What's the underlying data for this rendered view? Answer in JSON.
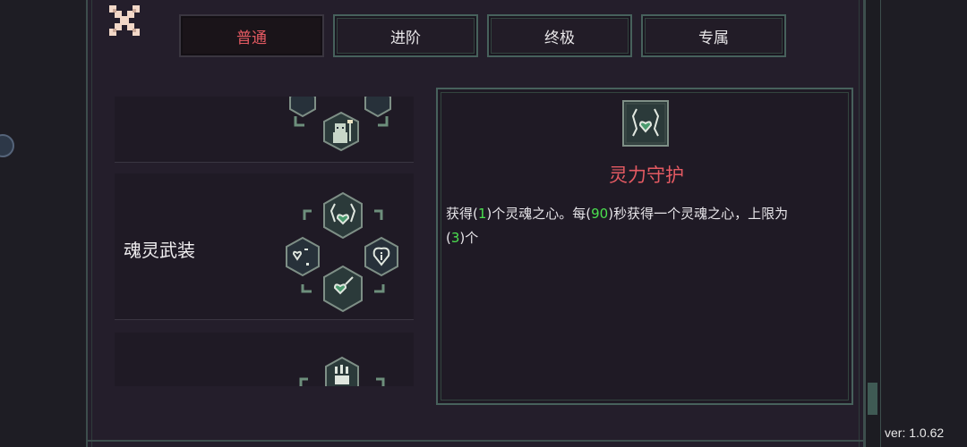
{
  "tabs": [
    {
      "label": "普通",
      "active": true
    },
    {
      "label": "进阶",
      "active": false
    },
    {
      "label": "终极",
      "active": false
    },
    {
      "label": "专属",
      "active": false
    }
  ],
  "list": {
    "items": [
      {
        "label": ""
      },
      {
        "label": "魂灵武装"
      },
      {
        "label": ""
      }
    ]
  },
  "detail": {
    "title": "灵力守护",
    "desc": {
      "p1": "获得(",
      "v1": "1",
      "p2": ")个灵魂之心。每(",
      "v2": "90",
      "p3": ")秒获得一个灵魂之心，上限为",
      "p4": "(",
      "v3": "3",
      "p5": ")个"
    }
  },
  "version": "ver: 1.0.62",
  "colors": {
    "accent": "#e45a62",
    "highlight": "#4be04f",
    "frame": "#47615c",
    "panel_bg": "#241e2b"
  },
  "icons": {
    "close": "close-icon",
    "detail": "soul-guard-icon"
  }
}
